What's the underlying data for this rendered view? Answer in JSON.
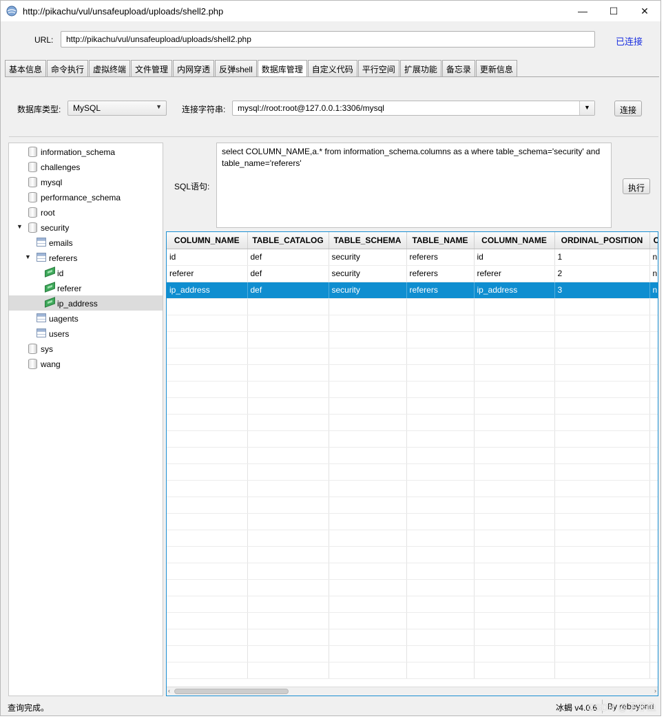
{
  "window": {
    "title": "http://pikachu/vul/unsafeupload/uploads/shell2.php",
    "icon": "globe-app-icon",
    "controls": [
      "—",
      "☐",
      "✕"
    ]
  },
  "urlbar": {
    "label": "URL:",
    "value": "http://pikachu/vul/unsafeupload/uploads/shell2.php",
    "status": "已连接",
    "status_color": "#1a2fe0"
  },
  "tabs": [
    "基本信息",
    "命令执行",
    "虚拟终端",
    "文件管理",
    "内网穿透",
    "反弹shell",
    "数据库管理",
    "自定义代码",
    "平行空间",
    "扩展功能",
    "备忘录",
    "更新信息"
  ],
  "active_tab": "数据库管理",
  "db": {
    "type_label": "数据库类型:",
    "type_value": "MySQL",
    "conn_label": "连接字符串:",
    "conn_value": "mysql://root:root@127.0.0.1:3306/mysql",
    "connect_button": "连接"
  },
  "tree": [
    {
      "label": "information_schema",
      "kind": "database"
    },
    {
      "label": "challenges",
      "kind": "database"
    },
    {
      "label": "mysql",
      "kind": "database"
    },
    {
      "label": "performance_schema",
      "kind": "database"
    },
    {
      "label": "root",
      "kind": "database"
    },
    {
      "label": "security",
      "kind": "database",
      "expanded": true
    },
    {
      "label": "emails",
      "kind": "table"
    },
    {
      "label": "referers",
      "kind": "table",
      "expanded": true
    },
    {
      "label": "id",
      "kind": "column"
    },
    {
      "label": "referer",
      "kind": "column"
    },
    {
      "label": "ip_address",
      "kind": "column",
      "selected": true
    },
    {
      "label": "uagents",
      "kind": "table"
    },
    {
      "label": "users",
      "kind": "table"
    },
    {
      "label": "sys",
      "kind": "database"
    },
    {
      "label": "wang",
      "kind": "database"
    }
  ],
  "sql": {
    "label": "SQL语句:",
    "query": "select COLUMN_NAME,a.* from information_schema.columns as a where table_schema='security' and table_name='referers'",
    "execute_button": "执行"
  },
  "results": {
    "columns": [
      "COLUMN_NAME",
      "TABLE_CATALOG",
      "TABLE_SCHEMA",
      "TABLE_NAME",
      "COLUMN_NAME",
      "ORDINAL_POSITION",
      "C"
    ],
    "rows": [
      [
        "id",
        "def",
        "security",
        "referers",
        "id",
        "1",
        "n"
      ],
      [
        "referer",
        "def",
        "security",
        "referers",
        "referer",
        "2",
        "n"
      ],
      [
        "ip_address",
        "def",
        "security",
        "referers",
        "ip_address",
        "3",
        "n"
      ]
    ],
    "selected_row": 2
  },
  "status": {
    "text": "查询完成。",
    "version": "冰蝎 v4.0.6",
    "author": "By rebeyond"
  },
  "watermark": "CSDN @子非鱼"
}
